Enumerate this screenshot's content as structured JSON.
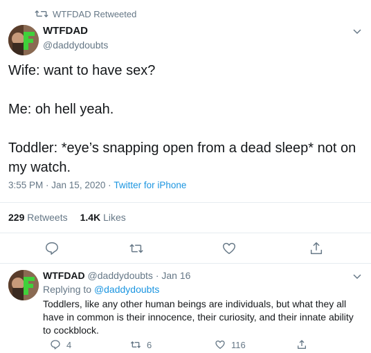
{
  "retweet_bar": {
    "text": "WTFDAD Retweeted"
  },
  "tweet": {
    "name": "WTFDAD",
    "handle": "@daddydoubts",
    "lines": [
      "Wife: want to have sex?",
      "Me: oh hell yeah.",
      "Toddler: *eye’s snapping open from a dead sleep* not on my watch."
    ],
    "time": "3:55 PM",
    "sep1": " · ",
    "date": "Jan 15, 2020",
    "sep2": " · ",
    "source": "Twitter for iPhone",
    "retweets_count": "229",
    "retweets_label": "Retweets",
    "likes_count": "1.4K",
    "likes_label": "Likes"
  },
  "reply": {
    "name": "WTFDAD",
    "header_rest": " @daddydoubts · Jan 16",
    "replying_prefix": "Replying to ",
    "replying_handle": "@daddydoubts",
    "text": "Toddlers, like any other human beings are individuals, but what they all have in common is their innocence, their curiosity, and their innate ability to cockblock.",
    "reply_count": "4",
    "retweet_count": "6",
    "like_count": "116"
  },
  "colors": {
    "text": "#14171a",
    "muted": "#657786",
    "link": "#1b95e0",
    "divider": "#e6ecf0",
    "logo_green": "#3fd13a"
  },
  "icons": {
    "retweet": "retweet-icon",
    "caret": "chevron-down-icon",
    "reply": "reply-icon",
    "like": "heart-icon",
    "share": "share-icon"
  }
}
